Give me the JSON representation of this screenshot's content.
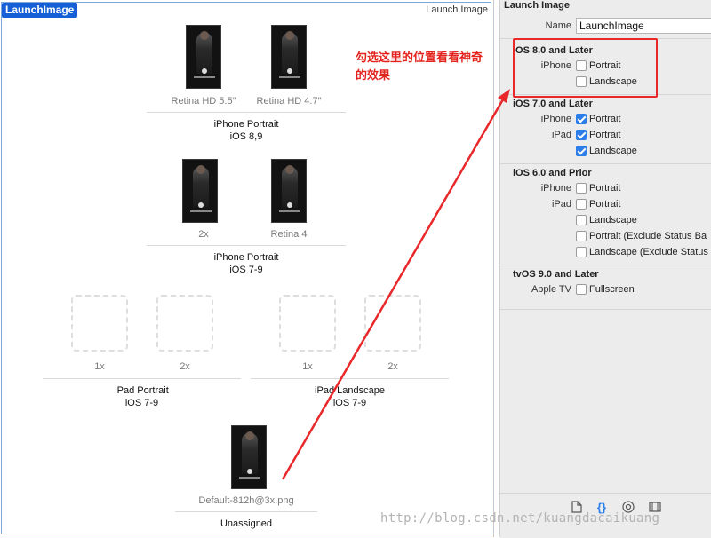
{
  "canvas": {
    "set_name": "LaunchImage",
    "set_type": "Launch Image",
    "groups": {
      "iphone8": {
        "slots": [
          {
            "label": "Retina HD 5.5″"
          },
          {
            "label": "Retina HD 4.7″"
          }
        ],
        "title": "iPhone Portrait",
        "subtitle": "iOS 8,9"
      },
      "iphone7": {
        "slots": [
          {
            "label": "2x"
          },
          {
            "label": "Retina 4"
          }
        ],
        "title": "iPhone Portrait",
        "subtitle": "iOS 7-9"
      },
      "ipad_portrait": {
        "slots": [
          {
            "label": "1x"
          },
          {
            "label": "2x"
          }
        ],
        "title": "iPad Portrait",
        "subtitle": "iOS 7-9"
      },
      "ipad_landscape": {
        "slots": [
          {
            "label": "1x"
          },
          {
            "label": "2x"
          }
        ],
        "title": "iPad Landscape",
        "subtitle": "iOS 7-9"
      },
      "unassigned": {
        "file": "Default-812h@3x.png",
        "title": "Unassigned"
      }
    }
  },
  "annotation": {
    "text": "勾选这里的位置看看神奇的效果",
    "color": "#e3241e"
  },
  "inspector": {
    "header": "Launch Image",
    "name_label": "Name",
    "name_value": "LaunchImage",
    "sections": {
      "ios8": {
        "title": "iOS 8.0 and Later",
        "iphone_label": "iPhone",
        "portrait": {
          "label": "Portrait",
          "checked": false
        },
        "landscape": {
          "label": "Landscape",
          "checked": false
        }
      },
      "ios7": {
        "title": "iOS 7.0 and Later",
        "iphone_label": "iPhone",
        "iphone_portrait": {
          "label": "Portrait",
          "checked": true
        },
        "ipad_label": "iPad",
        "ipad_portrait": {
          "label": "Portrait",
          "checked": true
        },
        "ipad_landscape": {
          "label": "Landscape",
          "checked": true
        }
      },
      "ios6": {
        "title": "iOS 6.0 and Prior",
        "iphone_label": "iPhone",
        "iphone_portrait": {
          "label": "Portrait",
          "checked": false
        },
        "ipad_label": "iPad",
        "ipad_portrait": {
          "label": "Portrait",
          "checked": false
        },
        "ipad_landscape": {
          "label": "Landscape",
          "checked": false
        },
        "portrait_exclude": {
          "label": "Portrait (Exclude Status Ba",
          "checked": false
        },
        "landscape_exclude": {
          "label": "Landscape (Exclude Status",
          "checked": false
        }
      },
      "tvos": {
        "title": "tvOS 9.0 and Later",
        "appletv_label": "Apple TV",
        "fullscreen": {
          "label": "Fullscreen",
          "checked": false
        }
      }
    },
    "toolbar": {
      "icons": [
        "file-icon",
        "braces-icon",
        "circle-target-icon",
        "film-strip-icon"
      ],
      "active_color": "#2b7de9"
    }
  },
  "watermark": "http://blog.csdn.net/kuangdacaikuang",
  "colors": {
    "selection_blue": "#1560d6",
    "checkbox_blue": "#2b7de9",
    "annotation_red": "#e8282b"
  }
}
